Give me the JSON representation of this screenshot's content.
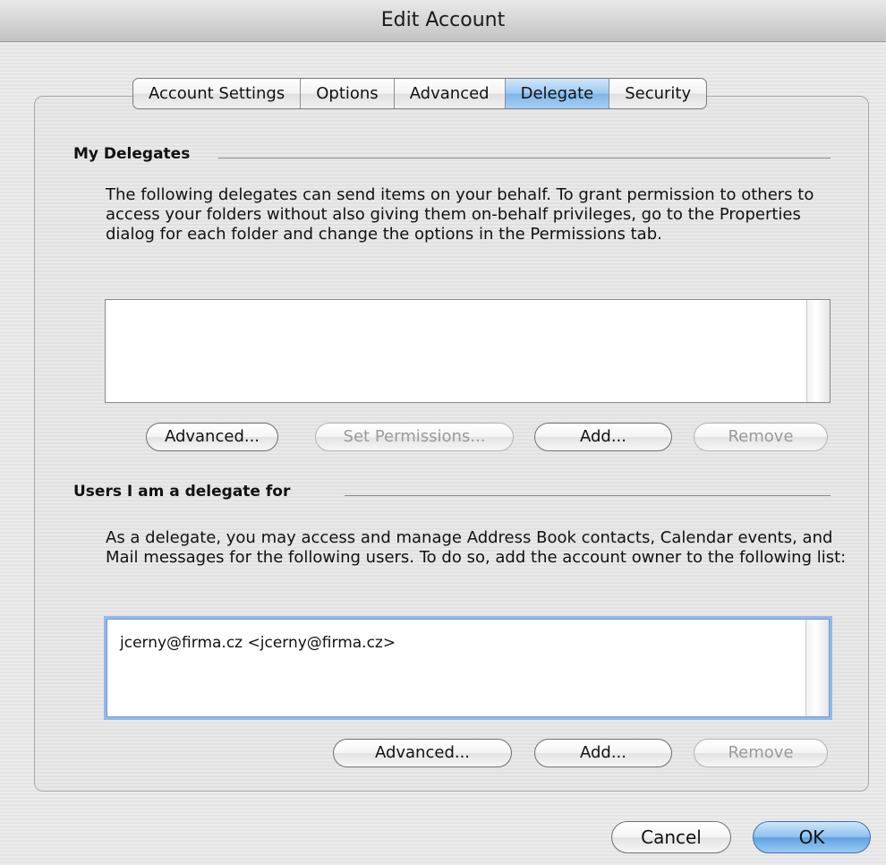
{
  "window": {
    "title": "Edit Account"
  },
  "tabs": [
    {
      "label": "Account Settings",
      "selected": false
    },
    {
      "label": "Options",
      "selected": false
    },
    {
      "label": "Advanced",
      "selected": false
    },
    {
      "label": "Delegate",
      "selected": true
    },
    {
      "label": "Security",
      "selected": false
    }
  ],
  "my_delegates": {
    "title": "My Delegates",
    "description": "The following delegates can send items on your behalf. To grant permission to others to access your folders without also giving them on-behalf privileges, go to the Properties dialog for each folder and change the options in the Permissions tab.",
    "items": [],
    "buttons": {
      "advanced": "Advanced...",
      "set_permissions": "Set Permissions...",
      "add": "Add...",
      "remove": "Remove"
    }
  },
  "delegate_for": {
    "title": "Users I am a delegate for",
    "description": "As a delegate, you may access and manage Address Book contacts, Calendar events, and Mail messages for the following users. To do so, add the account owner to the following list:",
    "items": [
      "jcerny@firma.cz <jcerny@firma.cz>"
    ],
    "buttons": {
      "advanced": "Advanced...",
      "add": "Add...",
      "remove": "Remove"
    }
  },
  "footer": {
    "cancel": "Cancel",
    "ok": "OK"
  },
  "colors": {
    "accent": "#7fb4e8",
    "focus_ring": "#93b9e8"
  }
}
